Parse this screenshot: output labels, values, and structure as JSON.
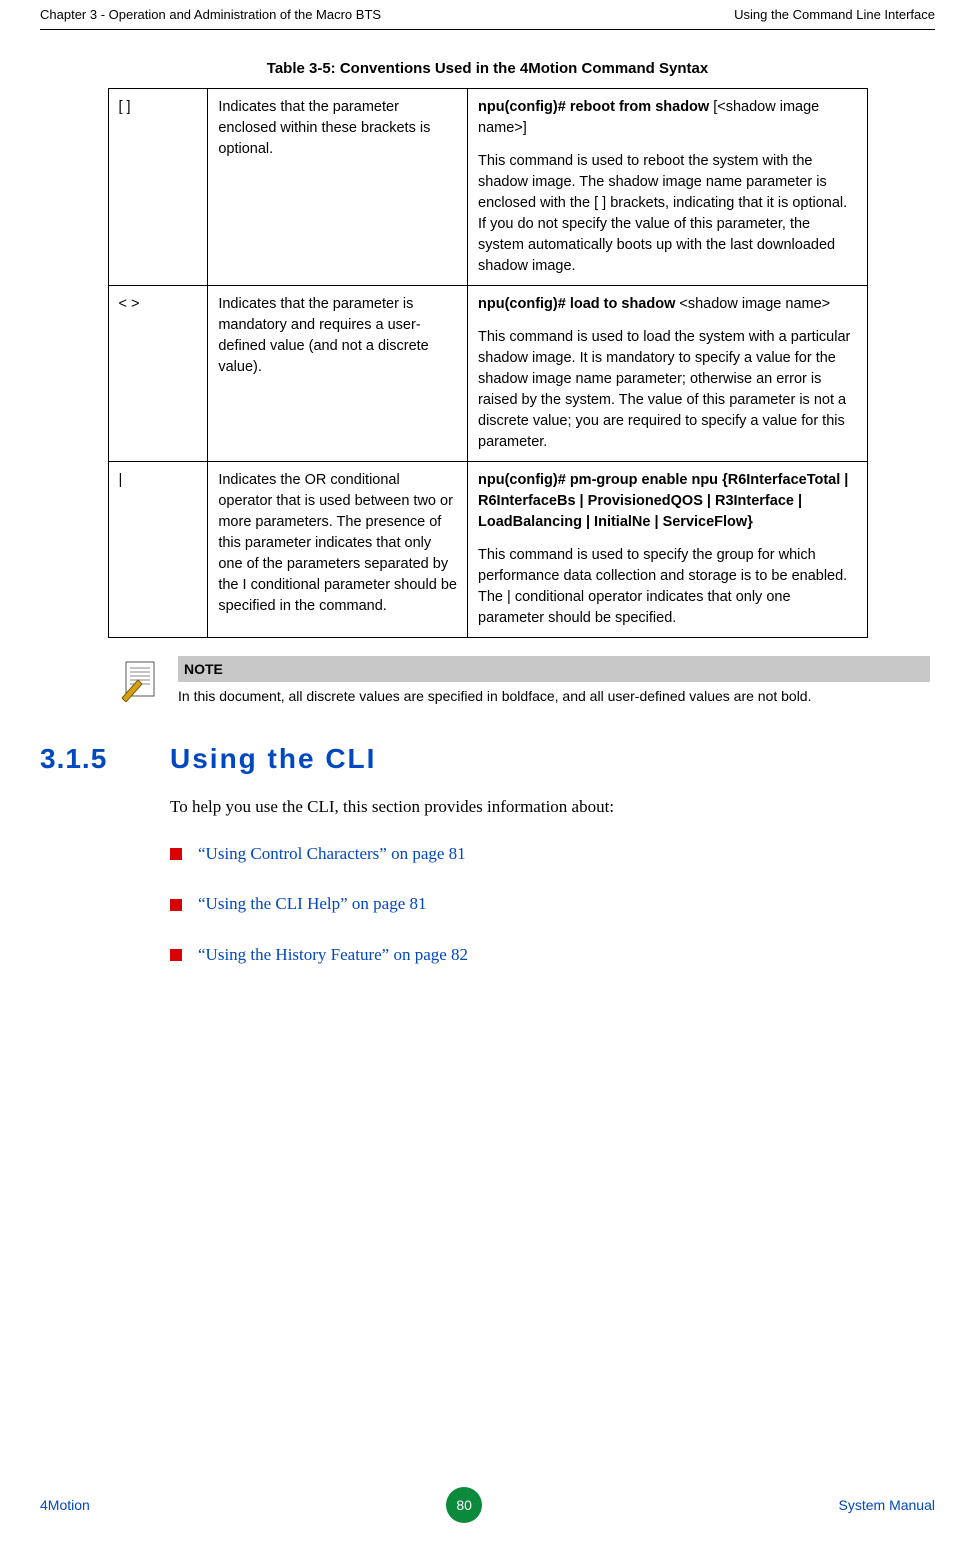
{
  "header": {
    "left": "Chapter 3 - Operation and Administration of the Macro BTS",
    "right": "Using the Command Line Interface"
  },
  "table": {
    "caption": "Table 3-5: Conventions Used in the 4Motion Command Syntax",
    "rows": [
      {
        "symbol": "[ ]",
        "desc": "Indicates that the parameter enclosed within these brackets is optional.",
        "ex_cmd": "npu(config)# reboot from shadow",
        "ex_param": " [<shadow image name>]",
        "ex_text": "This command is used to reboot the system with the shadow image. The shadow image name parameter is enclosed with the [ ] brackets, indicating that it is optional. If you do not specify the value of this parameter, the system automatically boots up with the last downloaded shadow image."
      },
      {
        "symbol": "< >",
        "desc": "Indicates that the parameter is mandatory and requires a user-defined value (and not a discrete value).",
        "ex_cmd": "npu(config)# load to shadow",
        "ex_param": " <shadow image name>",
        "ex_text": "This command is used to load the system with a particular shadow image. It is mandatory to specify a value for the shadow image name parameter; otherwise an error is raised by the system. The value of this parameter is not a discrete value; you are required to specify a value for this parameter."
      },
      {
        "symbol": "|",
        "desc": "Indicates the OR conditional operator that is used between two or more parameters. The presence of this parameter indicates that only one of the parameters separated by the I conditional parameter should be specified in the command.",
        "ex_cmd": "npu(config)# pm-group enable npu",
        "ex_param": " {R6InterfaceTotal | R6InterfaceBs | ProvisionedQOS | R3Interface | LoadBalancing | InitialNe | ServiceFlow}",
        "ex_text": "This command is used to specify the group for which performance data collection and storage is to be enabled. The | conditional operator indicates that only one parameter should be specified."
      }
    ]
  },
  "note": {
    "title": "NOTE",
    "text": "In this document, all discrete values are specified in boldface, and all user-defined values are not bold."
  },
  "section": {
    "number": "3.1.5",
    "title": "Using the CLI",
    "intro": "To help you use the CLI, this section provides information about:",
    "links": [
      "“Using Control Characters” on page 81",
      "“Using the CLI Help” on page 81",
      "“Using the History Feature” on page 82"
    ]
  },
  "footer": {
    "left": "4Motion",
    "page": "80",
    "right": "System Manual"
  }
}
